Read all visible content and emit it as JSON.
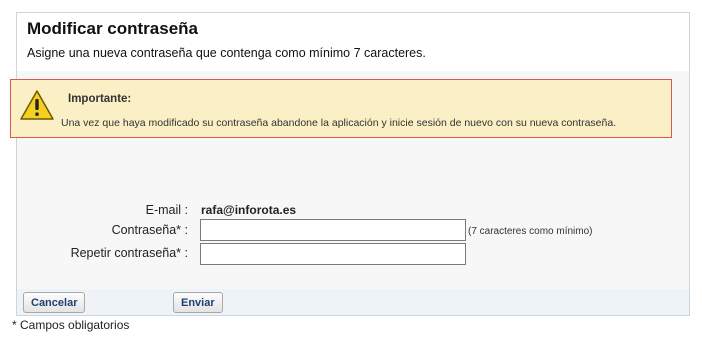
{
  "header": {
    "title": "Modificar contraseña",
    "subtitle": "Asigne una nueva contraseña que contenga como mínimo 7 caracteres."
  },
  "warning": {
    "icon": "warning-icon",
    "title": "Importante:",
    "text": "Una vez que haya modificado su contraseña abandone la aplicación y inicie sesión de nuevo con su nueva contraseña."
  },
  "form": {
    "email_label": "E-mail :",
    "email_value": "rafa@inforota.es",
    "password_label": "Contraseña* :",
    "password_value": "",
    "password_hint": "(7 caracteres como mínimo)",
    "repeat_label": "Repetir contraseña* :",
    "repeat_value": ""
  },
  "buttons": {
    "cancel": "Cancelar",
    "submit": "Enviar"
  },
  "footnote": "* Campos obligatorios",
  "colors": {
    "warning_bg": "#fbefc5",
    "warning_border": "#d9594f",
    "button_text": "#1f3f6e"
  }
}
